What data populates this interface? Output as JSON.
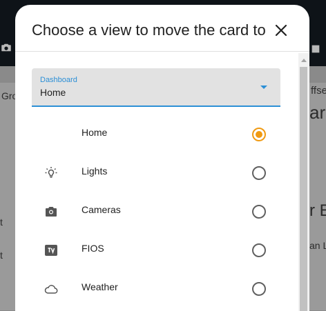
{
  "background": {
    "left_texts": [
      "Gro",
      "t",
      "t"
    ],
    "right_texts": [
      "ffse",
      "ar",
      "r E",
      "an L"
    ]
  },
  "dialog": {
    "title": "Choose a view to move the card to",
    "close_icon": "close-icon"
  },
  "select": {
    "label": "Dashboard",
    "value": "Home"
  },
  "views": [
    {
      "label": "Home",
      "icon": "none",
      "checked": true
    },
    {
      "label": "Lights",
      "icon": "lightbulb-icon",
      "checked": false
    },
    {
      "label": "Cameras",
      "icon": "camera-icon",
      "checked": false
    },
    {
      "label": "FIOS",
      "icon": "tv-icon",
      "checked": false
    },
    {
      "label": "Weather",
      "icon": "cloud-icon",
      "checked": false
    }
  ],
  "colors": {
    "accent": "#f09a12",
    "primary": "#2b8fd6"
  }
}
